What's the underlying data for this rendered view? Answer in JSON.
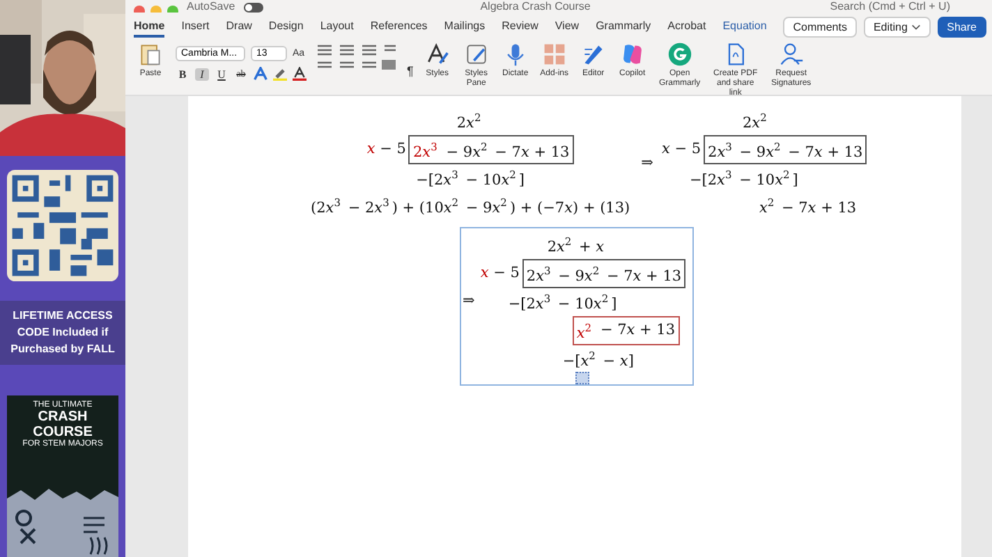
{
  "promo": {
    "banner": "LIFETIME ACCESS CODE Included if Purchased by FALL",
    "book": {
      "kicker": "THE ULTIMATE",
      "title": "CRASH COURSE",
      "subtitle": "FOR STEM MAJORS"
    }
  },
  "titlebar": {
    "autosave": "AutoSave",
    "autosave_on": false,
    "document": "Algebra Crash Course",
    "search": {
      "placeholder": "Search (Cmd + Ctrl + U)"
    }
  },
  "tabs": [
    {
      "label": "Home",
      "selected": true,
      "kind": "normal"
    },
    {
      "label": "Insert",
      "selected": false,
      "kind": "normal"
    },
    {
      "label": "Draw",
      "selected": false,
      "kind": "normal"
    },
    {
      "label": "Design",
      "selected": false,
      "kind": "normal"
    },
    {
      "label": "Layout",
      "selected": false,
      "kind": "normal"
    },
    {
      "label": "References",
      "selected": false,
      "kind": "normal"
    },
    {
      "label": "Mailings",
      "selected": false,
      "kind": "normal"
    },
    {
      "label": "Review",
      "selected": false,
      "kind": "normal"
    },
    {
      "label": "View",
      "selected": false,
      "kind": "normal"
    },
    {
      "label": "Grammarly",
      "selected": false,
      "kind": "normal"
    },
    {
      "label": "Acrobat",
      "selected": false,
      "kind": "normal"
    },
    {
      "label": "Equation",
      "selected": false,
      "kind": "contextual"
    }
  ],
  "header_buttons": {
    "comments": "Comments",
    "editing": "Editing",
    "share": "Share"
  },
  "ribbon": {
    "paste": "Paste",
    "font": "Cambria M...",
    "size": "13",
    "bold": "B",
    "italic": "I",
    "italic_on": true,
    "underline": "U",
    "strike": "ab",
    "case": "Aa",
    "styles": "Styles",
    "styles_pane": "Styles Pane",
    "dictate": "Dictate",
    "addins": "Add-ins",
    "editor": "Editor",
    "copilot": "Copilot",
    "grammarly": "Open Grammarly",
    "create_pdf": "Create PDF and share link",
    "signatures": "Request Signatures",
    "pilcrow": "¶"
  },
  "document": {
    "division_1": {
      "quotient": "2𝑥$^{2}$",
      "divisor_var": "𝑥",
      "divisor_var_highlight": true,
      "divisor_rest": "− 5",
      "dividend_lead": "2𝑥$^{3}$",
      "dividend_lead_highlight": true,
      "dividend_rest": "− 9𝑥$^{2}$ − 7𝑥 + 13",
      "subtract": "−[2𝑥$^{3}$ − 10𝑥$^{2}$]",
      "result": "(2𝑥$^{3}$ − 2𝑥$^{3}$) + (10𝑥$^{2}$ − 9𝑥$^{2}$) + (−7𝑥) + (13)"
    },
    "arrow_1": "⇒",
    "division_2": {
      "quotient": "2𝑥$^{2}$",
      "divisor": "𝑥 − 5",
      "dividend": "2𝑥$^{3}$ − 9𝑥$^{2}$ − 7𝑥 + 13",
      "subtract": "−[2𝑥$^{3}$ − 10𝑥$^{2}$]",
      "result": "𝑥$^{2}$ − 7𝑥 + 13"
    },
    "arrow_2": "⇒",
    "division_3": {
      "quotient": "2𝑥$^{2}$ + 𝑥",
      "divisor_var": "𝑥",
      "divisor_var_highlight": true,
      "divisor_rest": "− 5",
      "dividend": "2𝑥$^{3}$ − 9𝑥$^{2}$ − 7𝑥 + 13",
      "subtract": "−[2𝑥$^{3}$ − 10𝑥$^{2}$]",
      "remainder_lead": "𝑥$^{2}$",
      "remainder_lead_highlight": true,
      "remainder_rest": "− 7𝑥 + 13",
      "subtract_2": "−[𝑥$^{2}$ − 𝑥]"
    }
  }
}
